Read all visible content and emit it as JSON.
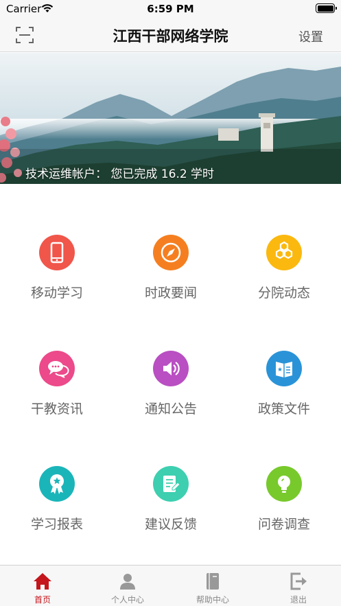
{
  "status_bar": {
    "carrier": "Carrier",
    "time": "6:59 PM"
  },
  "nav": {
    "title": "江西干部网络学院",
    "settings_label": "设置"
  },
  "banner": {
    "caption": "技术运维帐户：  您已完成 16.2 学时"
  },
  "grid": [
    {
      "label": "移动学习",
      "icon": "mobile-phone-icon",
      "color": "#f0564a"
    },
    {
      "label": "时政要闻",
      "icon": "compass-icon",
      "color": "#f57f20"
    },
    {
      "label": "分院动态",
      "icon": "hexagons-icon",
      "color": "#fbb80f"
    },
    {
      "label": "干教资讯",
      "icon": "chat-bubbles-icon",
      "color": "#ec4a8a"
    },
    {
      "label": "通知公告",
      "icon": "speaker-icon",
      "color": "#b94fc2"
    },
    {
      "label": "政策文件",
      "icon": "policy-book-icon",
      "color": "#2a93d8"
    },
    {
      "label": "学习报表",
      "icon": "award-badge-icon",
      "color": "#1ab5b9"
    },
    {
      "label": "建议反馈",
      "icon": "feedback-note-icon",
      "color": "#3dcfb0"
    },
    {
      "label": "问卷调查",
      "icon": "lightbulb-icon",
      "color": "#78c92c"
    }
  ],
  "tabs": [
    {
      "label": "首页",
      "icon": "home-icon",
      "active": true
    },
    {
      "label": "个人中心",
      "icon": "user-icon",
      "active": false
    },
    {
      "label": "帮助中心",
      "icon": "help-book-icon",
      "active": false
    },
    {
      "label": "退出",
      "icon": "logout-icon",
      "active": false
    }
  ],
  "colors": {
    "accent_active_tab": "#c4161c",
    "inactive_tab": "#888888",
    "bar_background": "#f7f7f7"
  }
}
